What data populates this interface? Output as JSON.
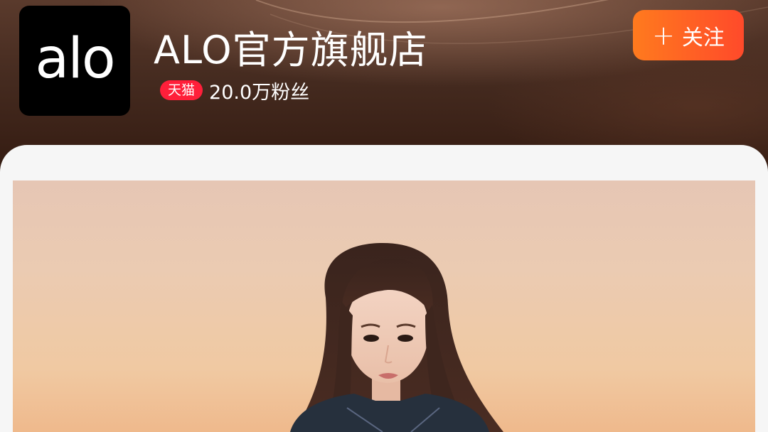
{
  "store": {
    "logo_text": "alo",
    "name": "ALO官方旗舰店",
    "badge": "天猫",
    "fans": "20.0万粉丝"
  },
  "follow": {
    "label": "关注",
    "icon": "plus-icon"
  },
  "colors": {
    "header_bg": "#442a1f",
    "follow_gradient_start": "#ff7a1e",
    "follow_gradient_end": "#ff4a2a",
    "tmall_red": "#ff1f3a",
    "card_bg": "#f6f6f6"
  }
}
